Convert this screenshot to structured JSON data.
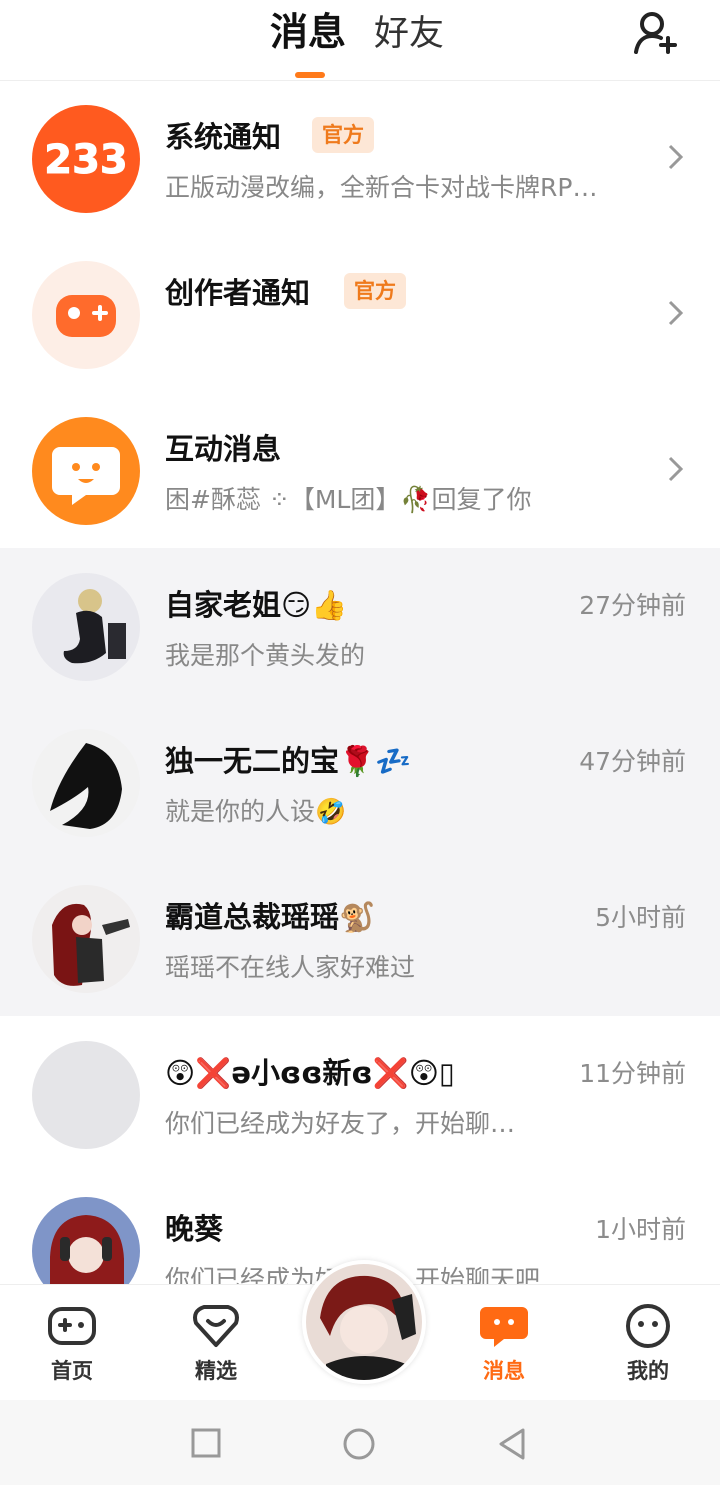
{
  "header": {
    "tabs": [
      {
        "label": "消息",
        "active": true
      },
      {
        "label": "好友",
        "active": false
      }
    ],
    "add_friend_icon": "add-user-icon",
    "accent_color": "#ff7a1a"
  },
  "notices": [
    {
      "name": "系统通知",
      "badge": "官方",
      "preview": "正版动漫改编，全新合卡对战卡牌RP…",
      "icon": "233-logo"
    },
    {
      "name": "创作者通知",
      "badge": "官方",
      "preview": "",
      "icon": "gamepad-plus-icon"
    },
    {
      "name": "互动消息",
      "preview": "困#酥蕊 ⁘【ML团】🥀回复了你",
      "icon": "chat-smile-icon"
    }
  ],
  "conversations": [
    {
      "name": "自家老姐😏👍",
      "preview": "我是那个黄头发的",
      "time": "27分钟前",
      "pinned": true
    },
    {
      "name": "独一无二的宝🌹💤",
      "preview": "就是你的人设🤣",
      "time": "47分钟前",
      "pinned": true
    },
    {
      "name": "霸道总裁瑶瑶🐒",
      "preview": "瑶瑶不在线人家好难过",
      "time": "5小时前",
      "pinned": true
    },
    {
      "name": "😲❌ə小ɞɞ新ɞ❌😲▯",
      "preview": "你们已经成为好友了，开始聊…",
      "time": "11分钟前",
      "pinned": false
    },
    {
      "name": "晚葵",
      "preview": "你们已经成为好友了，开始聊天吧",
      "time": "1小时前",
      "pinned": false
    }
  ],
  "bottom_nav": {
    "items": [
      {
        "label": "首页",
        "icon": "gamepad-icon"
      },
      {
        "label": "精选",
        "icon": "heart-diamond-icon"
      },
      {
        "label": "消息",
        "icon": "message-icon",
        "active": true
      },
      {
        "label": "我的",
        "icon": "face-icon"
      }
    ],
    "active_color": "#ff6a13"
  }
}
